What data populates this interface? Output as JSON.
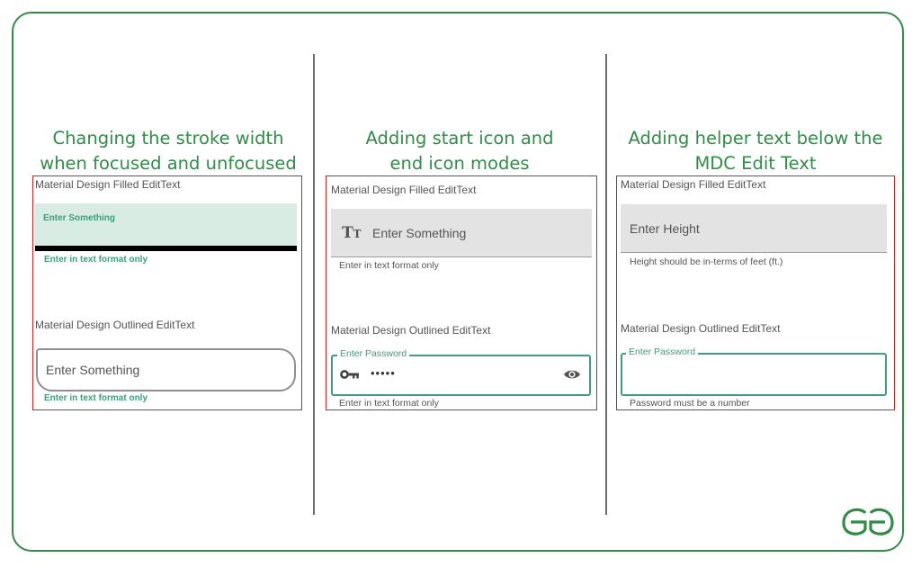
{
  "columns": [
    {
      "heading_line1": "Changing the stroke width",
      "heading_line2": "when focused and unfocused",
      "filled_label": "Material Design Filled EditText",
      "filled_hint": "Enter Something",
      "filled_helper": "Enter in text format only",
      "outlined_label": "Material Design Outlined EditText",
      "outlined_hint": "Enter Something",
      "outlined_helper": "Enter in text format only"
    },
    {
      "heading_line1": "Adding start icon and",
      "heading_line2": "end icon modes",
      "filled_label": "Material Design Filled EditText",
      "start_icon": "text-fields-icon",
      "filled_hint": "Enter Something",
      "filled_helper": "Enter in text format only",
      "outlined_label": "Material Design Outlined EditText",
      "outlined_floating_label": "Enter Password",
      "password_icon": "key-icon",
      "password_value": "•••••",
      "end_icon": "eye-icon",
      "outlined_helper": "Enter in text format only"
    },
    {
      "heading_line1": "Adding helper text below the",
      "heading_line2": "MDC Edit Text",
      "filled_label": "Material Design Filled EditText",
      "filled_hint": "Enter Height",
      "filled_helper": "Height should be in-terms of feet (ft.)",
      "outlined_label": "Material Design Outlined EditText",
      "outlined_floating_label": "Enter Password",
      "outlined_helper": "Password must be a number"
    }
  ],
  "logo_icon": "gfg-logo-icon",
  "colors": {
    "frame": "#2f8d46",
    "heading": "#2f8d46",
    "panel_border": "#e01b1b",
    "accent": "#3f9e7a",
    "divider": "#6d6d6d"
  }
}
